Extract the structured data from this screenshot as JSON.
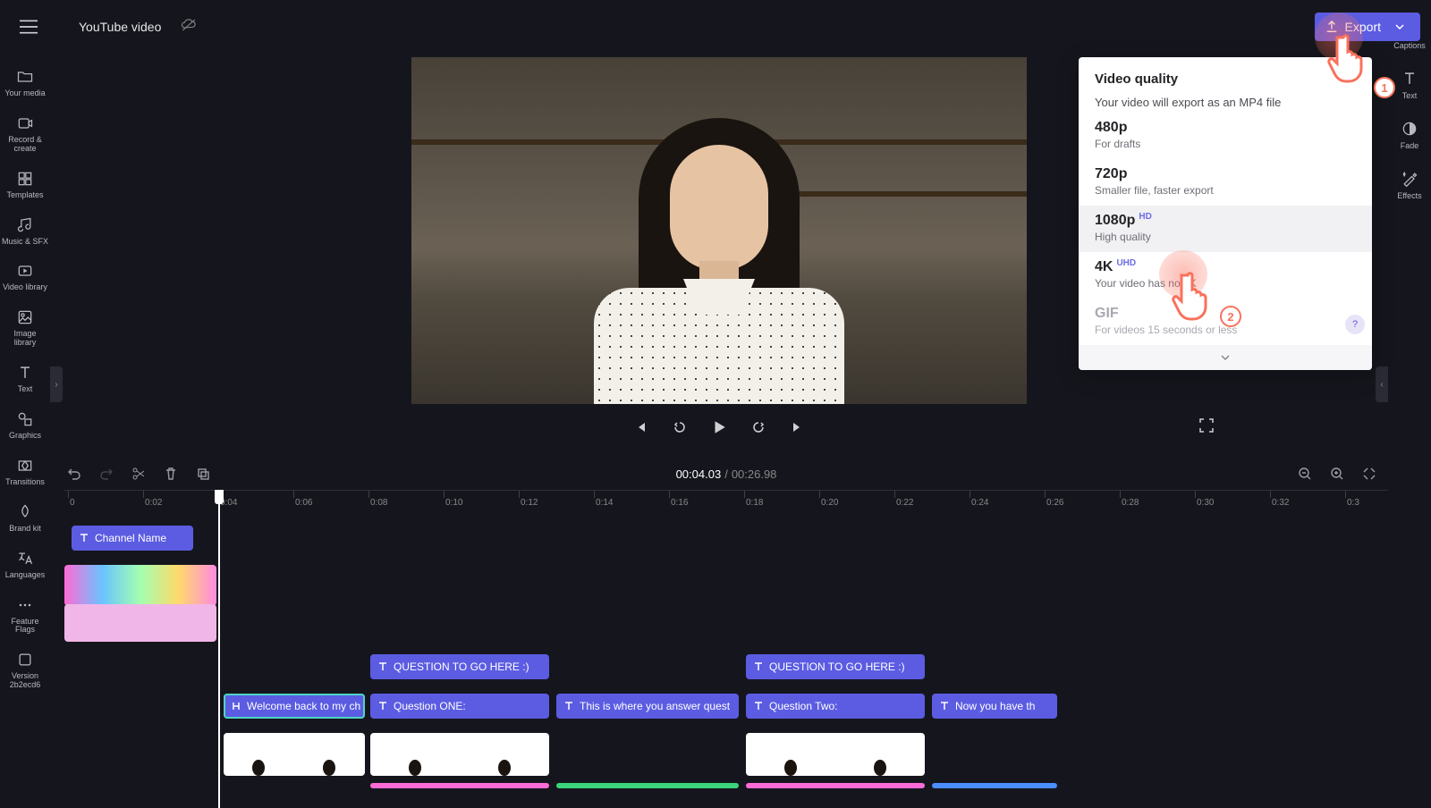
{
  "header": {
    "project_title": "YouTube video",
    "export_label": "Export"
  },
  "leftbar": {
    "items": [
      {
        "label": "Your media",
        "icon": "folder"
      },
      {
        "label": "Record &\ncreate",
        "icon": "camera"
      },
      {
        "label": "Templates",
        "icon": "grid"
      },
      {
        "label": "Music & SFX",
        "icon": "music"
      },
      {
        "label": "Video library",
        "icon": "film"
      },
      {
        "label": "Image\nlibrary",
        "icon": "image"
      },
      {
        "label": "Text",
        "icon": "text"
      },
      {
        "label": "Graphics",
        "icon": "shapes"
      },
      {
        "label": "Transitions",
        "icon": "transitions"
      },
      {
        "label": "Brand kit",
        "icon": "palette"
      },
      {
        "label": "Languages",
        "icon": "lang"
      },
      {
        "label": "Feature\nFlags",
        "icon": "dots"
      },
      {
        "label": "Version\n2b2ecd6",
        "icon": "version"
      }
    ]
  },
  "rightbar": {
    "items": [
      {
        "label": "Captions",
        "icon": "cc"
      },
      {
        "label": "Text",
        "icon": "text"
      },
      {
        "label": "Fade",
        "icon": "fade"
      },
      {
        "label": "Effects",
        "icon": "wand"
      }
    ]
  },
  "export_panel": {
    "title": "Video quality",
    "subtitle": "Your video will export as an MP4 file",
    "options": [
      {
        "label": "480p",
        "badge": "",
        "desc": "For drafts",
        "state": ""
      },
      {
        "label": "720p",
        "badge": "",
        "desc": "Smaller file, faster export",
        "state": ""
      },
      {
        "label": "1080p",
        "badge": "HD",
        "desc": "High quality",
        "state": "hover"
      },
      {
        "label": "4K",
        "badge": "UHD",
        "desc": "Your video has no 4K",
        "state": ""
      },
      {
        "label": "GIF",
        "badge": "",
        "desc": "For videos 15 seconds or less",
        "state": "disabled"
      }
    ]
  },
  "playback": {
    "current": "00:04.03",
    "duration": "00:26.98"
  },
  "ruler_ticks": [
    "0",
    "0:02",
    "0:04",
    "0:06",
    "0:08",
    "0:10",
    "0:12",
    "0:14",
    "0:16",
    "0:18",
    "0:20",
    "0:22",
    "0:24",
    "0:26",
    "0:28",
    "0:30",
    "0:32",
    "0:3"
  ],
  "timeline": {
    "clips": {
      "channel_name": "Channel Name",
      "welcome": "Welcome back to my ch",
      "q_header_1": "QUESTION TO GO HERE :)",
      "q_one": "Question ONE:",
      "answer": "This is where you answer quest",
      "q_header_2": "QUESTION TO GO HERE :)",
      "q_two": "Question Two:",
      "now_have": "Now you have th"
    }
  },
  "annotations": {
    "step1": "1",
    "step2": "2"
  }
}
